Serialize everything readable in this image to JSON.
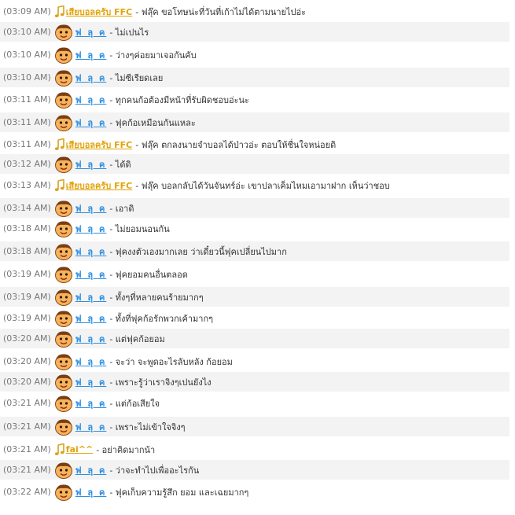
{
  "colors": {
    "host_name": "#e1a30a",
    "guest_name": "#2f8fe0",
    "timestamp": "#777777",
    "text": "#333333",
    "alt_row": "#f3f3f3"
  },
  "icons": {
    "host": "music-note-icon",
    "guest": "smiley-face-icon"
  },
  "messages": [
    {
      "time": "(03:09 AM)",
      "user": "เสียบอลครับ FFC",
      "role": "host",
      "text": " - ฟลุ๊ค ขอโทษน่ะที่วันที่เก้าไม่ได้ตามนายไปอ่ะ"
    },
    {
      "time": "(03:10 AM)",
      "user": "ฟ ลุ ค",
      "role": "guest",
      "text": " - ไม่เปนไร"
    },
    {
      "time": "(03:10 AM)",
      "user": "ฟ ลุ ค",
      "role": "guest",
      "text": " - ว่างๆค่อยมาเจอกันคับ"
    },
    {
      "time": "(03:10 AM)",
      "user": "ฟ ลุ ค",
      "role": "guest",
      "text": " - ไม่ซีเรียดเลย"
    },
    {
      "time": "(03:11 AM)",
      "user": "ฟ ลุ ค",
      "role": "guest",
      "text": " - ทุกคนก้อต้องมีหน้าที่รับผิดชอบอ่ะนะ"
    },
    {
      "time": "(03:11 AM)",
      "user": "ฟ ลุ ค",
      "role": "guest",
      "text": " - ฟุคก้อเหมือนกันแหละ"
    },
    {
      "time": "(03:11 AM)",
      "user": "เสียบอลครับ FFC",
      "role": "host",
      "text": " - ฟลุ๊ค ตกลงนายจำบอลได้ป่าวอ่ะ ตอบให้ชื่นใจหน่อยดิ"
    },
    {
      "time": "(03:12 AM)",
      "user": "ฟ ลุ ค",
      "role": "guest",
      "text": " - ได้ดิ"
    },
    {
      "time": "(03:13 AM)",
      "user": "เสียบอลครับ FFC",
      "role": "host",
      "text": " - ฟลุ๊ค บอลกลับได้วันจันทร์อ่ะ เขาปลาเค็มไหมเอามาฝาก เห็นว่าชอบ"
    },
    {
      "time": "(03:14 AM)",
      "user": "ฟ ลุ ค",
      "role": "guest",
      "text": " - เอาดิ"
    },
    {
      "time": "(03:18 AM)",
      "user": "ฟ ลุ ค",
      "role": "guest",
      "text": " - ไม่ยอมนอนกัน"
    },
    {
      "time": "(03:18 AM)",
      "user": "ฟ ลุ ค",
      "role": "guest",
      "text": " - ฟุคงงตัวเองมากเลย ว่าเดี๋ยวนี้ฟุคเปลี่ยนไปมาก"
    },
    {
      "time": "(03:19 AM)",
      "user": "ฟ ลุ ค",
      "role": "guest",
      "text": " - ฟุคยอมคนอื่นตลอด"
    },
    {
      "time": "(03:19 AM)",
      "user": "ฟ ลุ ค",
      "role": "guest",
      "text": " - ทั้งๆที่หลายคนร้ายมากๆ"
    },
    {
      "time": "(03:19 AM)",
      "user": "ฟ ลุ ค",
      "role": "guest",
      "text": " - ทั้งที่ฟุคก้อรักพวกเค้ามากๆ"
    },
    {
      "time": "(03:20 AM)",
      "user": "ฟ ลุ ค",
      "role": "guest",
      "text": " - แต่ฟุคก้อยอม"
    },
    {
      "time": "(03:20 AM)",
      "user": "ฟ ลุ ค",
      "role": "guest",
      "text": " - จะว่า จะพูดอะไรลับหลัง ก้อยอม"
    },
    {
      "time": "(03:20 AM)",
      "user": "ฟ ลุ ค",
      "role": "guest",
      "text": " - เพราะรู้ว่าเราจิงๆเปนยังไง"
    },
    {
      "time": "(03:21 AM)",
      "user": "ฟ ลุ ค",
      "role": "guest",
      "text": " - แต่ก้อเสียใจ"
    },
    {
      "time": "(03:21 AM)",
      "user": "ฟ ลุ ค",
      "role": "guest",
      "text": " - เพราะไม่เข้าใจจิงๆ"
    },
    {
      "time": "(03:21 AM)",
      "user": "fai^^",
      "role": "host",
      "text": " - อย่าคิดมากน้า"
    },
    {
      "time": "(03:21 AM)",
      "user": "ฟ ลุ ค",
      "role": "guest",
      "text": " - ว่าจะทำไปเพื่ออะไรกัน"
    },
    {
      "time": "(03:22 AM)",
      "user": "ฟ ลุ ค",
      "role": "guest",
      "text": " - ฟุคเก็บความรู้สึก ยอม และเฉยมากๆ"
    }
  ]
}
